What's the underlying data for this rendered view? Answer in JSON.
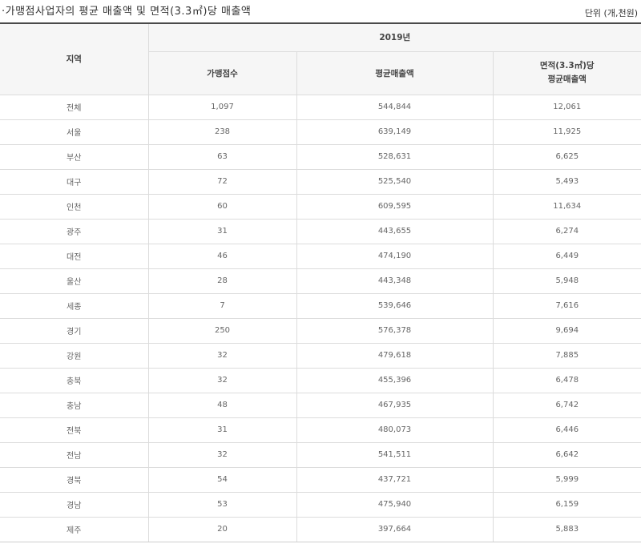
{
  "title": "가맹점사업자의 평균 매출액 및 면적(3.3㎡)당 매출액",
  "title_bullet": "·",
  "unit": "단위 (개,천원)",
  "header": {
    "region": "지역",
    "year": "2019년",
    "cols": [
      "가맹점수",
      "평균매출액"
    ],
    "area_col_line1": "면적(3.3㎡)당",
    "area_col_line2": "평균매출액"
  },
  "rows": [
    {
      "region": "전체",
      "stores": "1,097",
      "avg_sales": "544,844",
      "per_area": "12,061"
    },
    {
      "region": "서울",
      "stores": "238",
      "avg_sales": "639,149",
      "per_area": "11,925"
    },
    {
      "region": "부산",
      "stores": "63",
      "avg_sales": "528,631",
      "per_area": "6,625"
    },
    {
      "region": "대구",
      "stores": "72",
      "avg_sales": "525,540",
      "per_area": "5,493"
    },
    {
      "region": "인천",
      "stores": "60",
      "avg_sales": "609,595",
      "per_area": "11,634"
    },
    {
      "region": "광주",
      "stores": "31",
      "avg_sales": "443,655",
      "per_area": "6,274"
    },
    {
      "region": "대전",
      "stores": "46",
      "avg_sales": "474,190",
      "per_area": "6,449"
    },
    {
      "region": "울산",
      "stores": "28",
      "avg_sales": "443,348",
      "per_area": "5,948"
    },
    {
      "region": "세종",
      "stores": "7",
      "avg_sales": "539,646",
      "per_area": "7,616"
    },
    {
      "region": "경기",
      "stores": "250",
      "avg_sales": "576,378",
      "per_area": "9,694"
    },
    {
      "region": "강원",
      "stores": "32",
      "avg_sales": "479,618",
      "per_area": "7,885"
    },
    {
      "region": "충북",
      "stores": "32",
      "avg_sales": "455,396",
      "per_area": "6,478"
    },
    {
      "region": "충남",
      "stores": "48",
      "avg_sales": "467,935",
      "per_area": "6,742"
    },
    {
      "region": "전북",
      "stores": "31",
      "avg_sales": "480,073",
      "per_area": "6,446"
    },
    {
      "region": "전남",
      "stores": "32",
      "avg_sales": "541,511",
      "per_area": "6,642"
    },
    {
      "region": "경북",
      "stores": "54",
      "avg_sales": "437,721",
      "per_area": "5,999"
    },
    {
      "region": "경남",
      "stores": "53",
      "avg_sales": "475,940",
      "per_area": "6,159"
    },
    {
      "region": "제주",
      "stores": "20",
      "avg_sales": "397,664",
      "per_area": "5,883"
    }
  ]
}
